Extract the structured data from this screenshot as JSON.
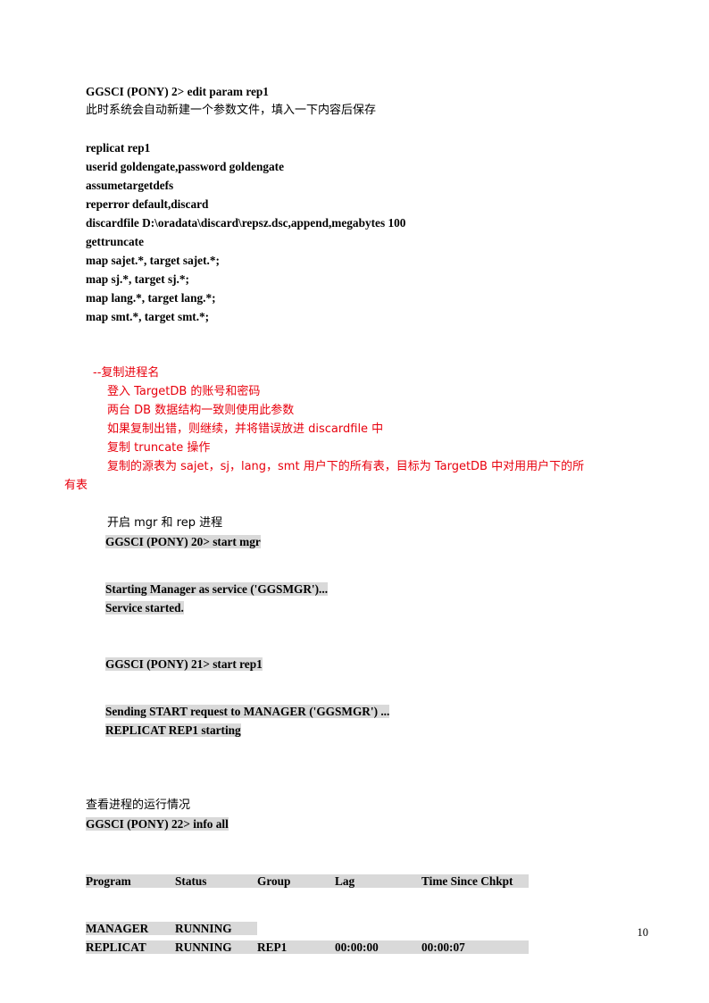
{
  "document": {
    "page_number": "10",
    "colors": {
      "highlight": "#d9d9d9",
      "annotation_red": "#e8000d",
      "text": "#000000"
    }
  },
  "section_edit_param": {
    "command": "GGSCI (PONY) 2> edit param rep1",
    "note_cn": "此时系统会自动新建一个参数文件，填入一下内容后保存"
  },
  "param_file": {
    "lines": [
      "replicat rep1",
      "userid goldengate,password goldengate",
      "assumetargetdefs",
      "reperror default,discard",
      "discardfile D:\\oradata\\discard\\repsz.dsc,append,megabytes 100",
      "gettruncate",
      "map sajet.*, target sajet.*;",
      "map sj.*, target sj.*;",
      "map lang.*, target lang.*;",
      "map smt.*, target smt.*;"
    ]
  },
  "annotations_red": {
    "lines": [
      "--复制进程名",
      "登入 TargetDB 的账号和密码",
      "两台 DB 数据结构一致则使用此参数",
      "如果复制出错，则继续，并将错误放进 discardfile 中",
      "复制 truncate 操作",
      "复制的源表为 sajet，sj，lang，smt 用户下的所有表，目标为 TargetDB 中对用用户下的所"
    ],
    "wrap_tail": "有表"
  },
  "section_start": {
    "note_cn": "开启 mgr 和 rep 进程",
    "cmd_start_mgr": "GGSCI (PONY) 20> start mgr",
    "output_mgr": [
      "Starting Manager as service ('GGSMGR')...",
      "Service started."
    ],
    "cmd_start_rep1": "GGSCI (PONY) 21> start rep1",
    "output_rep1": [
      "Sending START request to MANAGER ('GGSMGR') ...",
      "REPLICAT REP1 starting"
    ]
  },
  "section_info_all": {
    "note_cn": "查看进程的运行情况",
    "command": "GGSCI (PONY) 22> info all",
    "table": {
      "headers": [
        "Program",
        "Status",
        "Group",
        "Lag",
        "Time Since Chkpt"
      ],
      "rows": [
        [
          "MANAGER",
          "RUNNING",
          "",
          "",
          ""
        ],
        [
          "REPLICAT",
          "RUNNING",
          "REP1",
          "00:00:00",
          "00:00:07"
        ]
      ]
    }
  }
}
